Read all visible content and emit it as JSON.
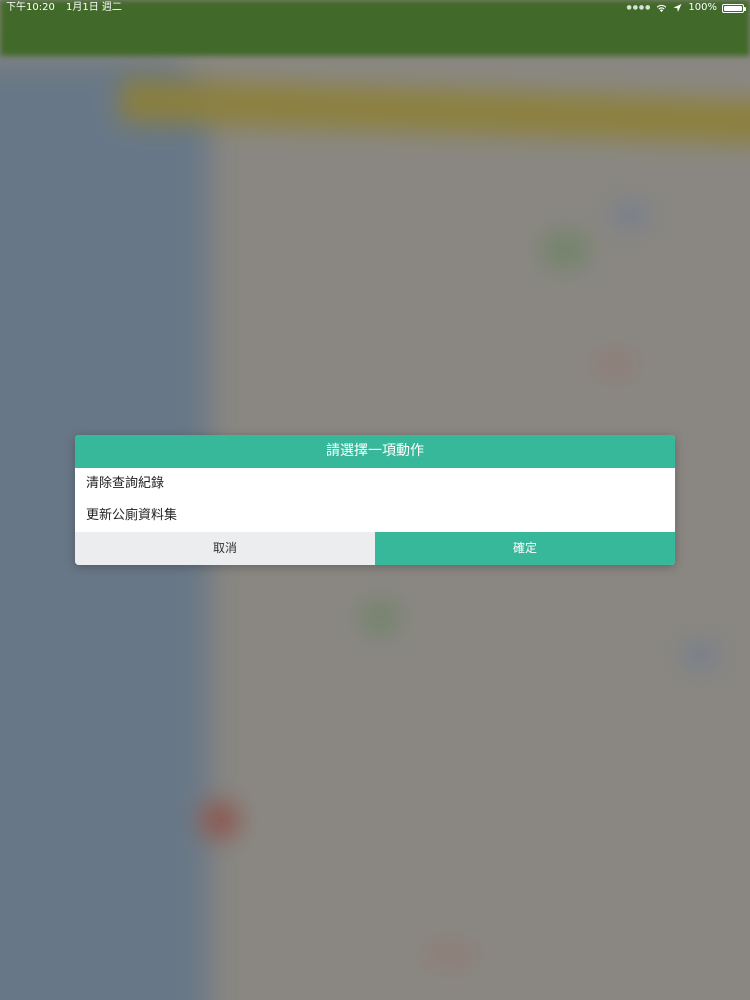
{
  "status_bar": {
    "time": "下午10:20",
    "date": "1月1日 週二",
    "battery_percent_label": "100%",
    "battery_level": 1.0,
    "icons": [
      "signal-dots",
      "wifi-icon",
      "location-icon",
      "battery-icon"
    ]
  },
  "dialog": {
    "title": "請選擇一項動作",
    "options": [
      {
        "label": "清除查詢紀錄"
      },
      {
        "label": "更新公廁資料集"
      }
    ],
    "cancel_label": "取消",
    "confirm_label": "確定"
  },
  "colors": {
    "accent": "#37b89b",
    "cancel_bg": "#ecedef",
    "app_bar": "#5aaa2a"
  }
}
